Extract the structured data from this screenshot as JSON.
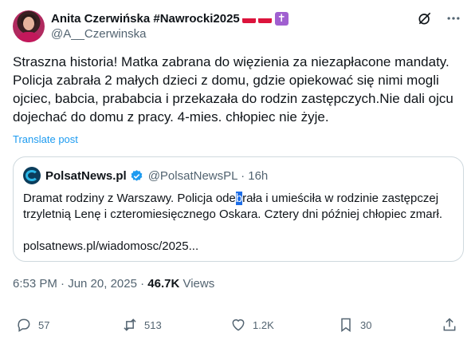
{
  "author": {
    "display_name": "Anita Czerwińska #Nawrocki2025",
    "handle": "@A__Czerwinska"
  },
  "tweet": {
    "text": "Straszna historia! Matka zabrana do więzienia za niezapłacone mandaty. Policja zabrała 2 małych dzieci z domu, gdzie opiekować się nimi mogli ojciec, babcia, prababcia i przekazała do rodzin zastępczych.Nie dali ojcu dojechać do domu z pracy. 4-mies. chłopiec nie żyje.",
    "translate_label": "Translate post"
  },
  "quote": {
    "name": "PolsatNews.pl",
    "handle_time": "@PolsatNewsPL · 16h",
    "text_before": "Dramat rodziny z Warszawy. Policja ode",
    "text_highlight": "b",
    "text_after": "rała i umieściła w rodzinie zastępczej trzyletnią Lenę i czteromiesięcznego Oskara. Cztery dni później chłopiec zmarł.",
    "link": "polsatnews.pl/wiadomosc/2025..."
  },
  "meta": {
    "timestamp": "6:53 PM · Jun 20, 2025 · ",
    "views_count": "46.7K",
    "views_label": " Views"
  },
  "actions": {
    "replies": "57",
    "reposts": "513",
    "likes": "1.2K",
    "bookmarks": "30"
  },
  "colors": {
    "accent": "#1d9bf0",
    "muted": "#536471",
    "border": "#cfd9de",
    "text": "#0f1419"
  }
}
